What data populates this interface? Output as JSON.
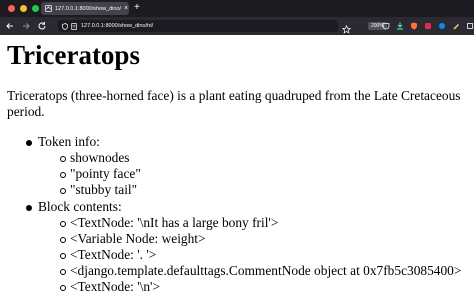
{
  "browser": {
    "tab_title": "127.0.0.1:8000/show_dino/tri/",
    "tab_close": "×",
    "new_tab": "+",
    "url": "127.0.0.1:8000/show_dino/tri/",
    "zoom": "200%"
  },
  "page": {
    "title": "Triceratops",
    "description": "Triceratops (three-horned face) is a plant eating quadruped from the Late Cretaceous period.",
    "list": {
      "token_info_label": "Token info:",
      "token_info_items": [
        "shownodes",
        "\"pointy face\"",
        "\"stubby tail\""
      ],
      "block_contents_label": "Block contents:",
      "block_contents_items": [
        "<TextNode: '\\nIt has a large bony fril'>",
        "<Variable Node: weight>",
        "<TextNode: '. '>",
        "<django.template.defaulttags.CommentNode object at 0x7fb5c3085400>",
        "<TextNode: '\\n'>"
      ]
    }
  },
  "colors": {
    "tabbar_bg": "#1c1b22",
    "navbar_bg": "#2b2a33",
    "active_tab_bg": "#42414d"
  }
}
